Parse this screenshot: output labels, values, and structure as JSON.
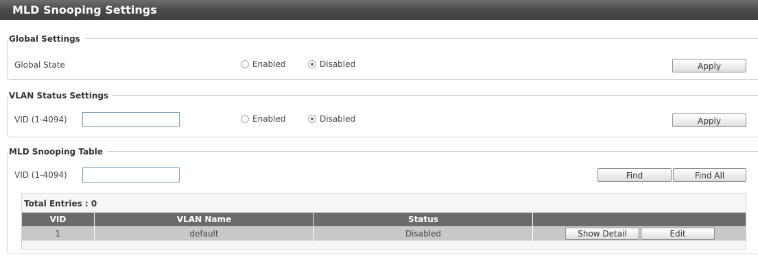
{
  "page": {
    "title": "MLD Snooping Settings"
  },
  "global_settings": {
    "legend": "Global Settings",
    "row_label": "Global State",
    "enabled_label": "Enabled",
    "disabled_label": "Disabled",
    "selected": "Disabled",
    "apply_label": "Apply"
  },
  "vlan_status": {
    "legend": "VLAN Status Settings",
    "vid_label": "VID (1-4094)",
    "vid_value": "",
    "enabled_label": "Enabled",
    "disabled_label": "Disabled",
    "selected": "Disabled",
    "apply_label": "Apply"
  },
  "snooping_table": {
    "legend": "MLD Snooping Table",
    "vid_label": "VID (1-4094)",
    "vid_value": "",
    "find_label": "Find",
    "find_all_label": "Find All",
    "total_entries": "Total Entries : 0",
    "columns": [
      "VID",
      "VLAN Name",
      "Status",
      ""
    ],
    "rows": [
      {
        "vid": "1",
        "vlan_name": "default",
        "status": "Disabled",
        "show_detail_label": "Show Detail",
        "edit_label": "Edit"
      }
    ]
  }
}
